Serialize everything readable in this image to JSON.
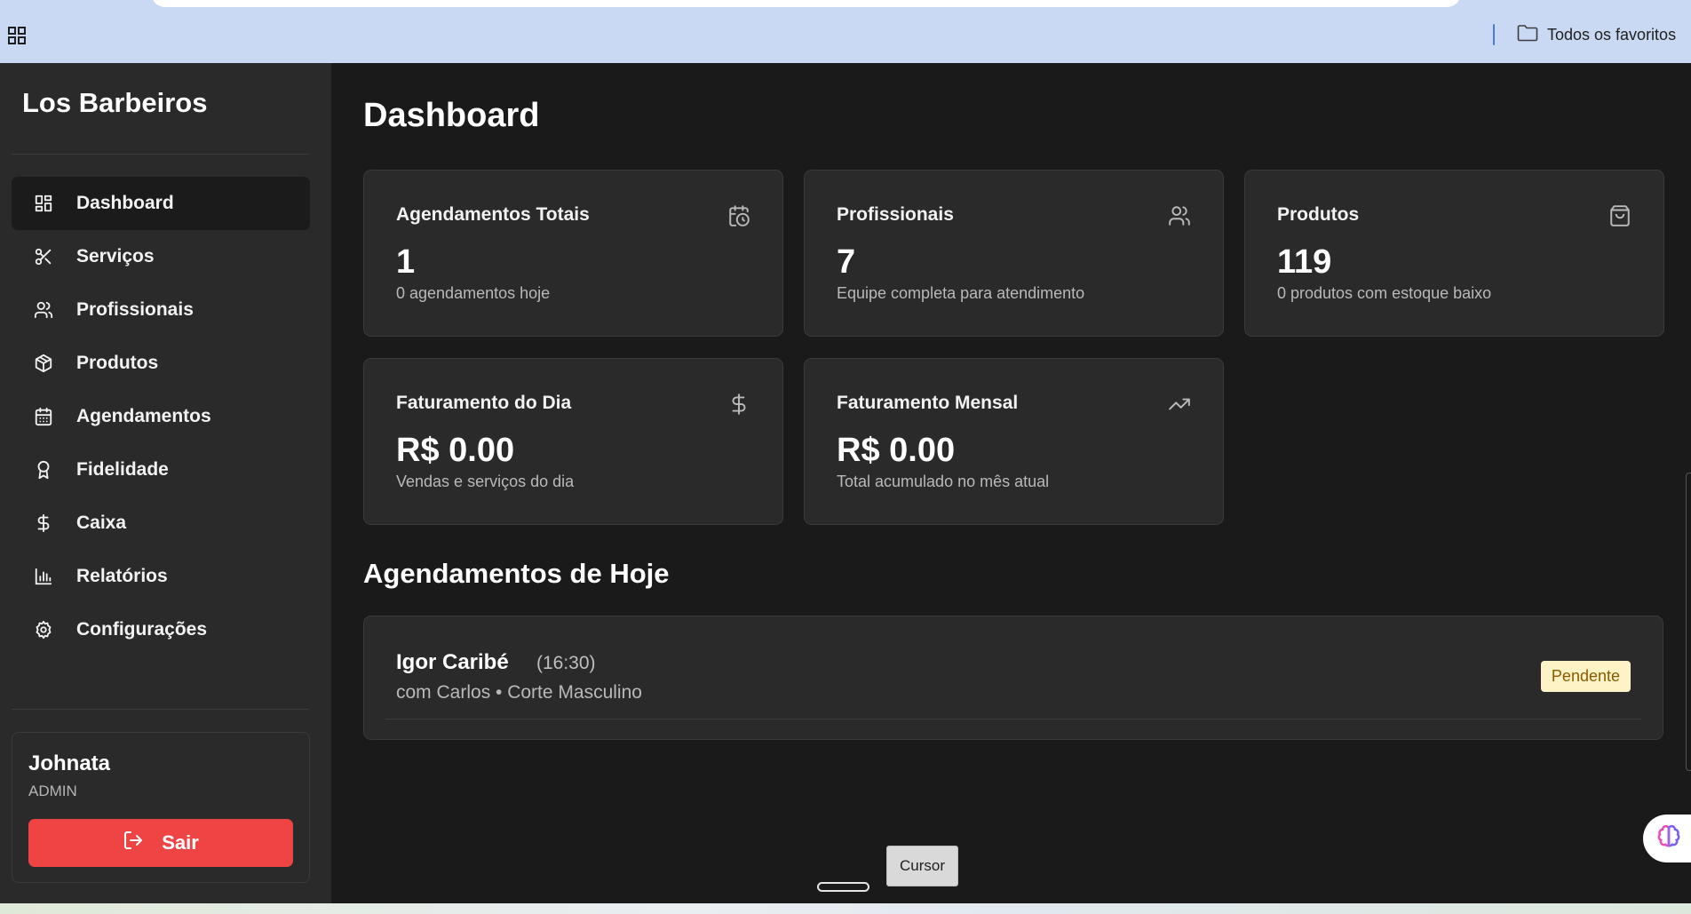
{
  "browser": {
    "favorites_label": "Todos os favoritos"
  },
  "sidebar": {
    "brand": "Los Barbeiros",
    "items": [
      {
        "label": "Dashboard",
        "icon": "dashboard-grid-icon",
        "active": true
      },
      {
        "label": "Serviços",
        "icon": "scissors-icon",
        "active": false
      },
      {
        "label": "Profissionais",
        "icon": "users-icon",
        "active": false
      },
      {
        "label": "Produtos",
        "icon": "package-icon",
        "active": false
      },
      {
        "label": "Agendamentos",
        "icon": "calendar-icon",
        "active": false
      },
      {
        "label": "Fidelidade",
        "icon": "award-icon",
        "active": false
      },
      {
        "label": "Caixa",
        "icon": "dollar-icon",
        "active": false
      },
      {
        "label": "Relatórios",
        "icon": "bar-chart-icon",
        "active": false
      },
      {
        "label": "Configurações",
        "icon": "gear-icon",
        "active": false
      }
    ],
    "user": {
      "name": "Johnata",
      "role": "ADMIN",
      "logout_label": "Sair"
    }
  },
  "main": {
    "title": "Dashboard",
    "cards": [
      {
        "title": "Agendamentos Totais",
        "value": "1",
        "subtitle": "0 agendamentos hoje",
        "icon": "calendar-clock-icon"
      },
      {
        "title": "Profissionais",
        "value": "7",
        "subtitle": "Equipe completa para atendimento",
        "icon": "users-icon"
      },
      {
        "title": "Produtos",
        "value": "119",
        "subtitle": "0 produtos com estoque baixo",
        "icon": "shopping-bag-icon"
      },
      {
        "title": "Faturamento do Dia",
        "value": "R$ 0.00",
        "subtitle": "Vendas e serviços do dia",
        "icon": "dollar-icon"
      },
      {
        "title": "Faturamento Mensal",
        "value": "R$ 0.00",
        "subtitle": "Total acumulado no mês atual",
        "icon": "trending-up-icon"
      }
    ],
    "today_section_title": "Agendamentos de Hoje",
    "appointments": [
      {
        "client": "Igor Caribé",
        "time": "(16:30)",
        "detail": "com Carlos • Corte Masculino",
        "status": "Pendente"
      }
    ]
  },
  "overlay": {
    "tooltip": "Cursor"
  },
  "colors": {
    "sidebar_bg": "#2a2a2a",
    "main_bg": "#1a1a1a",
    "card_bg": "#2a2a2a",
    "logout_red": "#ef4444",
    "pending_badge_bg": "#fef3c7",
    "browser_bar_bg": "#c9d9f3"
  }
}
